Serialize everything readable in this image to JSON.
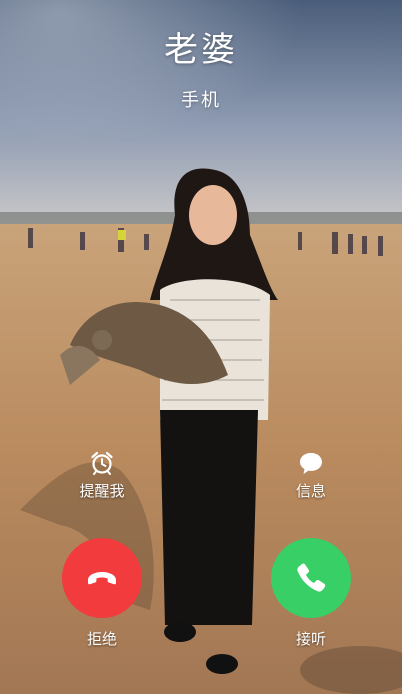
{
  "caller": {
    "name": "老婆",
    "label": "手机"
  },
  "actions": {
    "remind": {
      "label": "提醒我",
      "icon": "alarm-clock-icon"
    },
    "message": {
      "label": "信息",
      "icon": "message-bubble-icon"
    }
  },
  "buttons": {
    "decline": {
      "label": "拒绝",
      "icon": "phone-hangup-icon",
      "color": "#f13b3d"
    },
    "accept": {
      "label": "接听",
      "icon": "phone-icon",
      "color": "#37cf66"
    }
  },
  "background": {
    "description_icon": "contact-photo"
  }
}
